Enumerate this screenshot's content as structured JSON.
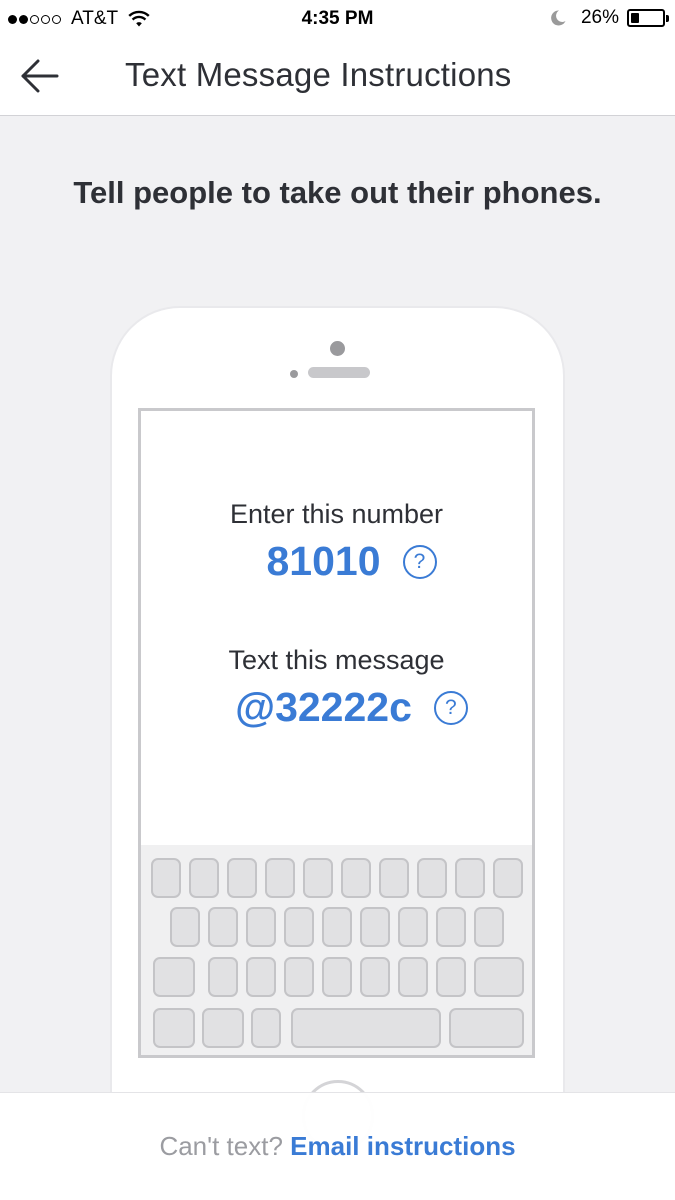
{
  "status_bar": {
    "carrier": "AT&T",
    "signal_bars": 2,
    "signal_total": 5,
    "time": "4:35 PM",
    "battery_percent": "26%",
    "battery_level": 0.26
  },
  "nav": {
    "title": "Text Message Instructions",
    "back_icon": "arrow-left-icon"
  },
  "heading": "Tell people to take out their phones.",
  "instructions": {
    "number_label": "Enter this number",
    "number_value": "81010",
    "message_label": "Text this message",
    "message_value": "@32222c",
    "help_glyph": "?"
  },
  "footer": {
    "prefix": "Can't text?",
    "link": "Email instructions"
  },
  "colors": {
    "accent": "#3a7bd5",
    "background": "#f1f1f3",
    "text": "#2e3036",
    "muted": "#9b9ca1"
  }
}
